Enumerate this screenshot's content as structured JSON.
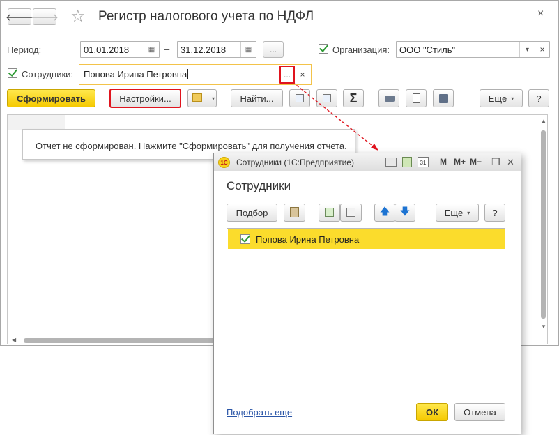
{
  "window": {
    "title": "Регистр налогового учета по НДФЛ",
    "close_glyph": "×",
    "back_glyph": "🡐",
    "forward_glyph": "🡒",
    "star_glyph": "☆"
  },
  "period": {
    "label": "Период:",
    "date_from": "01.01.2018",
    "date_to": "31.12.2018",
    "dash": "–",
    "calendar_glyph": "▦",
    "more_glyph": "..."
  },
  "organization": {
    "label": "Организация:",
    "value": "ООО \"Стиль\"",
    "checked": true,
    "dropdown_glyph": "▾",
    "clear_glyph": "×"
  },
  "employees": {
    "label": "Сотрудники:",
    "value": "Попова Ирина Петровна",
    "checked": true,
    "more_glyph": "...",
    "clear_glyph": "×"
  },
  "toolbar": {
    "generate_label": "Сформировать",
    "settings_label": "Настройки...",
    "find_label": "Найти...",
    "sum_glyph": "Σ",
    "more_label": "Еще",
    "help_label": "?",
    "caret": "▾"
  },
  "report": {
    "message": "Отчет не сформирован. Нажмите \"Сформировать\" для получения отчета."
  },
  "dialog": {
    "title": "Сотрудники  (1С:Предприятие)",
    "logo": "1С",
    "heading": "Сотрудники",
    "m_label": "M",
    "m_plus_label": "M+",
    "m_minus_label": "M−",
    "calendar_day": "31",
    "select_label": "Подбор",
    "more_label": "Еще",
    "help_label": "?",
    "caret": "▾",
    "up_glyph": "🡅",
    "down_glyph": "🡇",
    "items": [
      {
        "name": "Попова Ирина Петровна",
        "checked": true
      }
    ],
    "select_more_link": "Подобрать еще",
    "ok_label": "ОК",
    "cancel_label": "Отмена",
    "restore_glyph": "❐",
    "close_glyph": "✕"
  },
  "colors": {
    "accent_yellow": "#f5c900",
    "selection_yellow": "#fbdc2c",
    "highlight_red": "#e0141e",
    "check_green": "#2e9a34",
    "link_blue": "#2a55a7"
  }
}
